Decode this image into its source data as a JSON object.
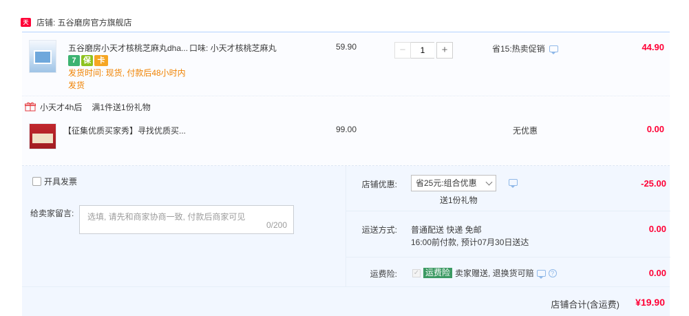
{
  "store": {
    "tmall_badge": "天猫",
    "name": "店铺: 五谷磨房官方旗舰店"
  },
  "item1": {
    "title": "五谷磨房小天才核桃芝麻丸dha...",
    "sku": "口味: 小天才核桃芝麻丸",
    "badges": [
      "7",
      "保",
      "卡"
    ],
    "delivery": "发货时间: 现货, 付款后48小时内发货",
    "price": "59.90",
    "quantity": "1",
    "minus": "−",
    "plus": "+",
    "promo": "省15:热卖促销",
    "subtotal": "44.90"
  },
  "gift": {
    "name": "小天才4h后",
    "rule": "满1件送1份礼物"
  },
  "item2": {
    "title": "【征集优质买家秀】寻找优质买...",
    "price": "99.00",
    "promo": "无优惠",
    "subtotal": "0.00"
  },
  "extras": {
    "invoice_label": "开具发票",
    "message_label": "给卖家留言:",
    "message_placeholder": "选填, 请先和商家协商一致, 付款后商家可见",
    "message_count": "0/200"
  },
  "store_discount": {
    "label": "店铺优惠:",
    "selected": "省25元:组合优惠",
    "gift_note": "送1份礼物",
    "amount": "-25.00"
  },
  "shipping": {
    "label": "运送方式:",
    "method": "普通配送 快递 免邮",
    "eta": "16:00前付款, 预计07月30日送达",
    "amount": "0.00"
  },
  "insurance": {
    "label": "运费险:",
    "badge": "运费险",
    "text": "卖家赠送, 退换货可赔",
    "amount": "0.00"
  },
  "total": {
    "label": "店铺合计(含运费)",
    "amount": "¥19.90"
  },
  "colors": {
    "accent": "#ff0036",
    "delivery": "#f08200",
    "panel": "#f2f7ff",
    "insurance": "#3c9a63"
  }
}
